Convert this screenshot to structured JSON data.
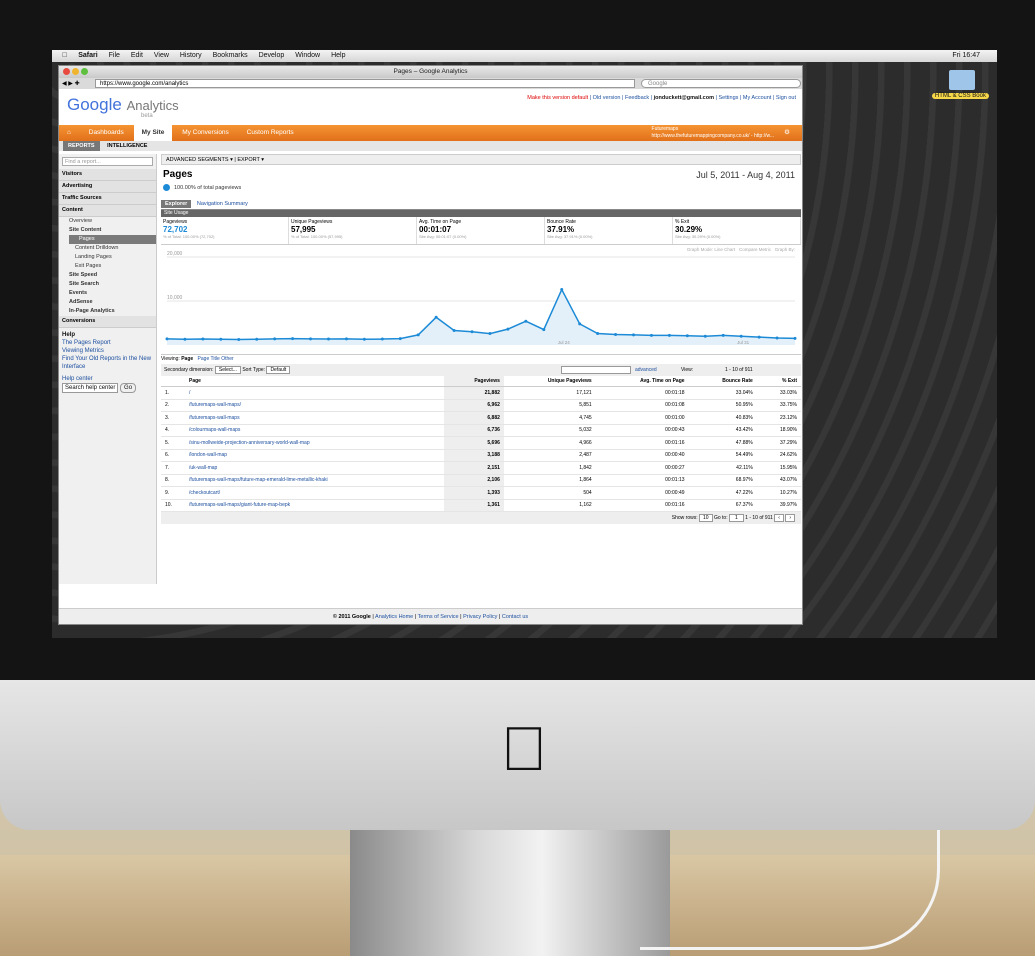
{
  "mac_menubar": {
    "items": [
      "Safari",
      "File",
      "Edit",
      "View",
      "History",
      "Bookmarks",
      "Develop",
      "Window",
      "Help"
    ],
    "clock": "Fri 16:47"
  },
  "desktop": {
    "folder_label": "HTML & CSS Book"
  },
  "browser": {
    "window_title": "Pages – Google Analytics",
    "url": "https://www.google.com/analytics",
    "search_placeholder": "Google"
  },
  "ga": {
    "logo_google": "Google",
    "logo_analytics": "Analytics",
    "logo_beta": "beta",
    "toplinks": {
      "make_default": "Make this version default",
      "old_version": "Old version",
      "feedback": "Feedback",
      "email": "jonduckett@gmail.com",
      "settings": "Settings",
      "my_account": "My Account",
      "sign_out": "Sign out"
    },
    "nav": [
      "Dashboards",
      "My Site",
      "My Conversions",
      "Custom Reports"
    ],
    "account_name": "Futuremaps",
    "account_url": "http://www.thefuturemappingcompany.co.uk/ - http://w...",
    "subtabs": [
      "REPORTS",
      "INTELLIGENCE"
    ]
  },
  "sidebar": {
    "find_placeholder": "Find a report...",
    "sections": [
      "Visitors",
      "Advertising",
      "Traffic Sources",
      "Content"
    ],
    "content_items": [
      "Overview",
      "Site Content",
      "Pages",
      "Content Drilldown",
      "Landing Pages",
      "Exit Pages",
      "Site Speed",
      "Site Search",
      "Events",
      "AdSense",
      "In-Page Analytics"
    ],
    "conversions": "Conversions",
    "help_title": "Help",
    "help_links": [
      "The Pages Report",
      "Viewing Metrics",
      "Find Your Old Reports in the New Interface"
    ],
    "help_center": "Help center",
    "search_help_placeholder": "Search help center",
    "go": "Go"
  },
  "report": {
    "advanced_segments": "ADVANCED SEGMENTS",
    "export": "EXPORT",
    "title": "Pages",
    "date_range": "Jul 5, 2011 - Aug 4, 2011",
    "pct_total": "100.00% of total pageviews",
    "tab_explorer": "Explorer",
    "tab_nav_summary": "Navigation Summary",
    "site_usage": "Site Usage",
    "metrics": [
      {
        "label": "Pageviews",
        "value": "72,702",
        "sub": "% of Total: 100.00% (72,702)"
      },
      {
        "label": "Unique Pageviews",
        "value": "57,995",
        "sub": "% of Total: 100.00% (57,995)"
      },
      {
        "label": "Avg. Time on Page",
        "value": "00:01:07",
        "sub": "Site Avg: 00:01:07 (0.00%)"
      },
      {
        "label": "Bounce Rate",
        "value": "37.91%",
        "sub": "Site Avg: 37.91% (0.00%)"
      },
      {
        "label": "% Exit",
        "value": "30.29%",
        "sub": "Site Avg: 30.29% (0.00%)"
      }
    ],
    "graph_controls": [
      "Graph Mode:",
      "Line Chart",
      "Compare Metric",
      "Graph By:"
    ],
    "viewing": "Viewing:",
    "viewing_opts": [
      "Page",
      "Page Title",
      "Other"
    ],
    "secondary_dimension": "Secondary dimension:",
    "select": "Select...",
    "sort_type": "Sort Type:",
    "default": "Default",
    "advanced": "advanced",
    "view": "View:",
    "pager": "1 - 10 of 911",
    "show_rows": "Show rows:",
    "rows_value": "10",
    "go_to": "Go to:",
    "go_to_value": "1",
    "columns": [
      "Page",
      "Pageviews",
      "Unique Pageviews",
      "Avg. Time on Page",
      "Bounce Rate",
      "% Exit"
    ],
    "rows": [
      [
        "1.",
        "/",
        "21,882",
        "17,121",
        "00:01:18",
        "33.04%",
        "33.03%"
      ],
      [
        "2.",
        "/futuremaps-wall-maps/",
        "6,962",
        "5,851",
        "00:01:08",
        "50.95%",
        "33.75%"
      ],
      [
        "3.",
        "/futuremaps-wall-maps",
        "6,882",
        "4,745",
        "00:01:00",
        "40.83%",
        "23.12%"
      ],
      [
        "4.",
        "/colourmaps-wall-maps",
        "6,736",
        "5,032",
        "00:00:43",
        "43.42%",
        "18.90%"
      ],
      [
        "5.",
        "/sinu-mollweide-projection-anniversary-world-wall-map",
        "5,696",
        "4,966",
        "00:01:16",
        "47.88%",
        "37.29%"
      ],
      [
        "6.",
        "/london-wall-map",
        "3,188",
        "2,487",
        "00:00:40",
        "54.49%",
        "24.62%"
      ],
      [
        "7.",
        "/uk-wall-map",
        "2,151",
        "1,842",
        "00:00:27",
        "42.11%",
        "15.95%"
      ],
      [
        "8.",
        "/futuremaps-wall-maps/future-map-emerald-lime-metallic-khaki",
        "2,106",
        "1,864",
        "00:01:13",
        "68.97%",
        "43.07%"
      ],
      [
        "9.",
        "/checkoutcart/",
        "1,393",
        "504",
        "00:00:49",
        "47.22%",
        "10.27%"
      ],
      [
        "10.",
        "/futuremaps-wall-maps/giant-future-map-bepk",
        "1,361",
        "1,162",
        "00:01:16",
        "67.37%",
        "39.97%"
      ]
    ],
    "footer": {
      "copyright": "© 2011 Google",
      "links": [
        "Analytics Home",
        "Terms of Service",
        "Privacy Policy",
        "Contact us"
      ]
    }
  },
  "chart_data": {
    "type": "line",
    "y_ticks": [
      "20,000",
      "10,000"
    ],
    "x_labels": [
      "Jul 24",
      "Jul 31"
    ],
    "series": [
      {
        "values": [
          1400,
          1300,
          1350,
          1300,
          1250,
          1300,
          1400,
          1450,
          1400,
          1350,
          1400,
          1300,
          1350,
          1450,
          2300,
          6300,
          3300,
          3000,
          2600,
          3600,
          5400,
          3500,
          12600,
          4800,
          2600,
          2400,
          2300,
          2200,
          2200,
          2100,
          2000,
          2200,
          2000,
          1800,
          1600,
          1500
        ]
      }
    ],
    "ylim": [
      0,
      20000
    ],
    "color": "#1c8ad6"
  }
}
